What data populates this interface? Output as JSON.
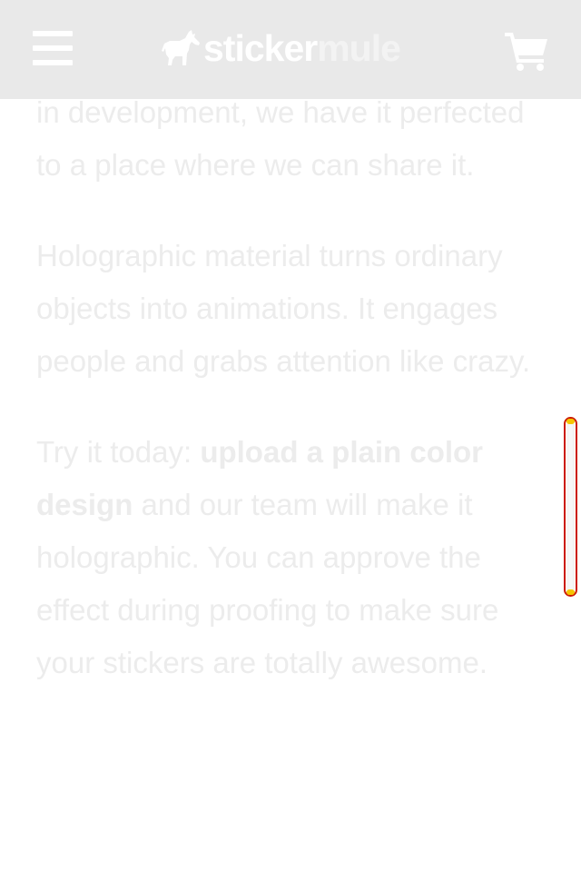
{
  "header": {
    "logo_word1": "sticker",
    "logo_word2": "mule",
    "menu_icon": "hamburger-menu-icon",
    "cart_icon": "shopping-cart-icon",
    "mule_icon": "mule-silhouette-icon",
    "colors": {
      "header_bg": "#e9e9e9",
      "logo_primary": "#ffffff",
      "logo_secondary": "#f3f3f3"
    }
  },
  "article": {
    "p1": "in development, we have it perfected to a place where we can share it.",
    "p2": "Holographic material turns ordinary objects into animations. It engages people and grabs attention like crazy.",
    "p3_lead": "Try it today: ",
    "p3_link": "upload a plain color design",
    "p3_rest": " and our team will make it holographic. You can approve the effect during proofing to make sure your stickers are totally awesome.",
    "text_color": "#ececec"
  },
  "scrollbar": {
    "border_color": "#cc1a00",
    "cap_color": "#f5c400"
  }
}
